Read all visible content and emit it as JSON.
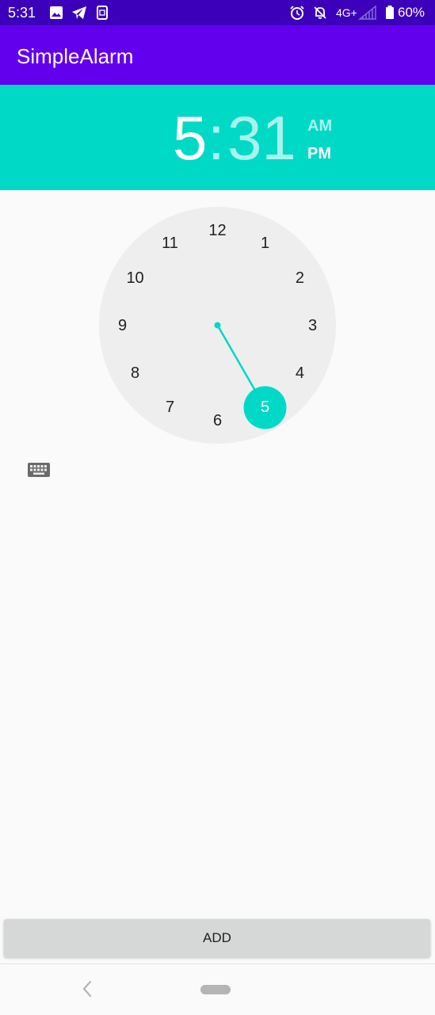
{
  "status_bar": {
    "time": "5:31",
    "icons": [
      "image-icon",
      "telegram-icon",
      "sim-icon",
      "alarm-icon",
      "notifications-off-icon",
      "signal-icon",
      "battery-icon"
    ],
    "network": "4G+",
    "battery": "60%"
  },
  "app_bar": {
    "title": "SimpleAlarm"
  },
  "time_header": {
    "hour": "5",
    "separator": ":",
    "minute": "31",
    "am_label": "AM",
    "pm_label": "PM",
    "selected_period": "PM"
  },
  "clock": {
    "numbers": [
      "12",
      "1",
      "2",
      "3",
      "4",
      "5",
      "6",
      "7",
      "8",
      "9",
      "10",
      "11"
    ],
    "selected": "5",
    "face_color": "#eeeeee",
    "accent_color": "#00d9c6"
  },
  "keyboard_toggle": {
    "icon": "keyboard-icon"
  },
  "actions": {
    "add_label": "ADD"
  },
  "nav_bar": {
    "back_icon": "back-icon",
    "home_icon": "home-pill-icon"
  },
  "colors": {
    "status_bar": "#3c00bb",
    "app_bar": "#6200ee",
    "header": "#00d9c6",
    "background": "#fafafa",
    "button": "#d6d7d7"
  }
}
